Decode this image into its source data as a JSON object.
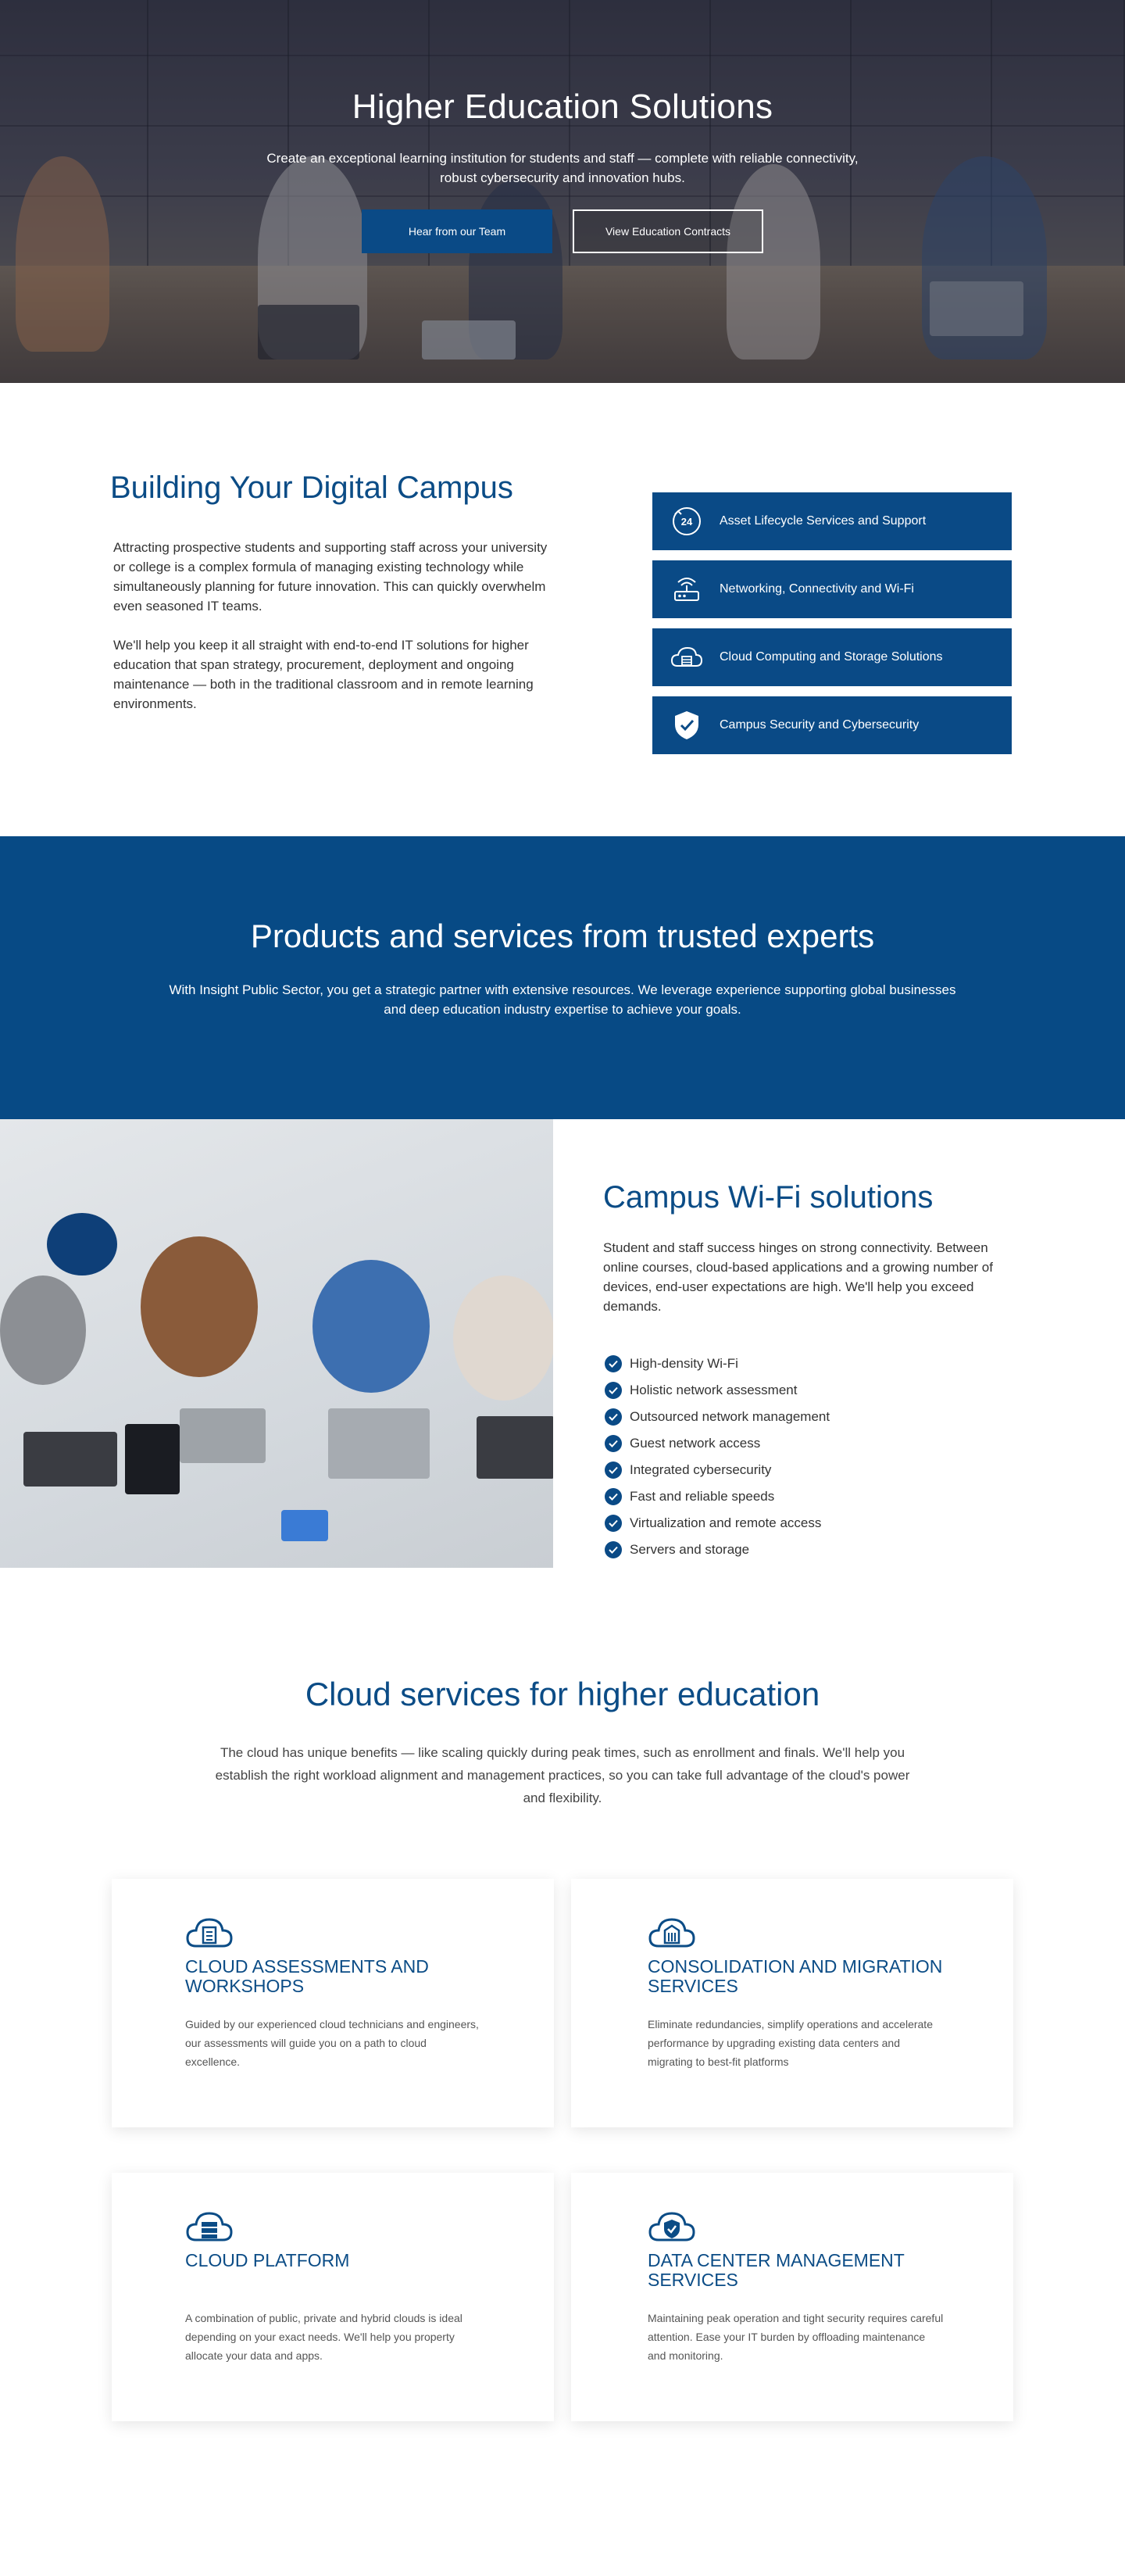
{
  "hero": {
    "title": "Higher Education Solutions",
    "subtitle": "Create an exceptional learning institution for students and staff — complete with reliable connectivity, robust cybersecurity and innovation hubs.",
    "primary_button": "Hear from our Team",
    "secondary_button": "View Education Contracts"
  },
  "campus": {
    "title": "Building Your Digital Campus",
    "paragraph1": "Attracting prospective students and supporting staff across your university or college is a complex formula of managing existing technology while simultaneously planning for future innovation. This can quickly overwhelm even seasoned IT teams.",
    "paragraph2": "We'll help you keep it all straight with end-to-end IT solutions for higher education that span strategy, procurement, deployment and ongoing maintenance — both in the traditional classroom and in remote learning environments.",
    "services": [
      {
        "label": "Asset Lifecycle Services and Support",
        "icon": "24-hour-support-icon"
      },
      {
        "label": "Networking, Connectivity and Wi-Fi",
        "icon": "router-icon"
      },
      {
        "label": "Cloud Computing and Storage Solutions",
        "icon": "cloud-storage-icon"
      },
      {
        "label": "Campus Security and Cybersecurity",
        "icon": "shield-check-icon"
      }
    ]
  },
  "products": {
    "title": "Products and services from trusted experts",
    "text": "With Insight Public Sector, you get a strategic partner with extensive resources. We leverage experience supporting global businesses and deep education industry expertise to achieve your goals."
  },
  "wifi": {
    "title": "Campus Wi-Fi solutions",
    "text": "Student and staff success hinges on strong connectivity. Between online courses, cloud-based applications and a growing number of devices, end-user expectations are high. We'll help you exceed demands.",
    "features": [
      "High-density Wi-Fi",
      "Holistic network assessment",
      "Outsourced network management",
      "Guest network access",
      "Integrated cybersecurity",
      "Fast and reliable speeds",
      "Virtualization and remote access",
      "Servers and storage"
    ]
  },
  "cloud": {
    "title": "Cloud services for higher education",
    "text": "The cloud has unique benefits — like scaling quickly during peak times, such as enrollment and finals. We'll help you establish the right workload alignment and management practices, so you can take full advantage of the cloud's power and flexibility.",
    "cards": [
      {
        "title": "CLOUD ASSESSMENTS AND WORKSHOPS",
        "text": "Guided by our experienced cloud technicians and engineers, our assessments will guide you on a path to cloud excellence.",
        "icon": "cloud-checklist-icon"
      },
      {
        "title": "CONSOLIDATION AND MIGRATION SERVICES",
        "text": "Eliminate redundancies, simplify operations and accelerate performance by upgrading existing data centers and migrating to best-fit platforms",
        "icon": "cloud-building-icon"
      },
      {
        "title": "CLOUD PLATFORM",
        "text": "A combination of public, private and hybrid clouds is ideal depending on your exact needs. We'll help you property allocate your data and apps.",
        "icon": "cloud-server-icon"
      },
      {
        "title": "DATA CENTER MANAGEMENT SERVICES",
        "text": "Maintaining peak operation and tight security requires careful attention. Ease your IT burden by offloading maintenance and monitoring.",
        "icon": "cloud-shield-icon"
      }
    ]
  },
  "colors": {
    "brand_blue": "#0a4a86",
    "band_blue": "#074a85",
    "heading_blue": "#0b4c86"
  }
}
